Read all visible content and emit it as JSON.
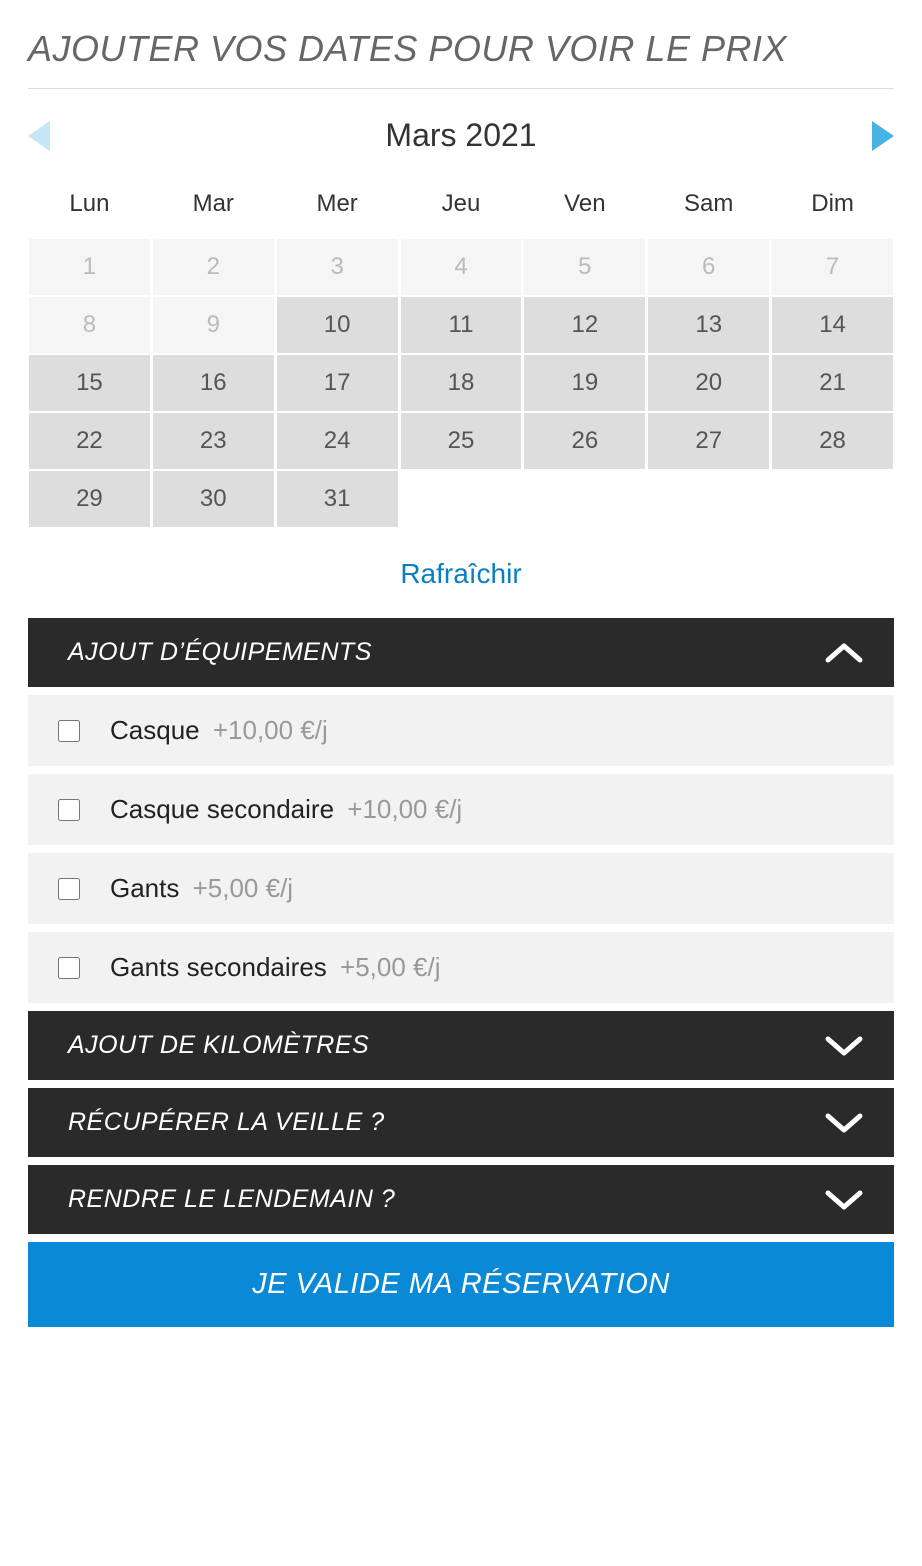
{
  "header": {
    "title": "AJOUTER VOS DATES POUR VOIR LE PRIX"
  },
  "calendar": {
    "month_label": "Mars 2021",
    "dow": [
      "Lun",
      "Mar",
      "Mer",
      "Jeu",
      "Ven",
      "Sam",
      "Dim"
    ],
    "cells": [
      {
        "d": "1",
        "state": "disabled"
      },
      {
        "d": "2",
        "state": "disabled"
      },
      {
        "d": "3",
        "state": "disabled"
      },
      {
        "d": "4",
        "state": "disabled"
      },
      {
        "d": "5",
        "state": "disabled"
      },
      {
        "d": "6",
        "state": "disabled"
      },
      {
        "d": "7",
        "state": "disabled"
      },
      {
        "d": "8",
        "state": "disabled"
      },
      {
        "d": "9",
        "state": "disabled"
      },
      {
        "d": "10",
        "state": "avail"
      },
      {
        "d": "11",
        "state": "avail"
      },
      {
        "d": "12",
        "state": "avail"
      },
      {
        "d": "13",
        "state": "avail"
      },
      {
        "d": "14",
        "state": "avail"
      },
      {
        "d": "15",
        "state": "avail"
      },
      {
        "d": "16",
        "state": "avail"
      },
      {
        "d": "17",
        "state": "avail"
      },
      {
        "d": "18",
        "state": "avail"
      },
      {
        "d": "19",
        "state": "avail"
      },
      {
        "d": "20",
        "state": "avail"
      },
      {
        "d": "21",
        "state": "avail"
      },
      {
        "d": "22",
        "state": "avail"
      },
      {
        "d": "23",
        "state": "avail"
      },
      {
        "d": "24",
        "state": "avail"
      },
      {
        "d": "25",
        "state": "avail"
      },
      {
        "d": "26",
        "state": "avail"
      },
      {
        "d": "27",
        "state": "avail"
      },
      {
        "d": "28",
        "state": "avail"
      },
      {
        "d": "29",
        "state": "avail"
      },
      {
        "d": "30",
        "state": "avail"
      },
      {
        "d": "31",
        "state": "avail"
      },
      {
        "d": "",
        "state": "empty"
      },
      {
        "d": "",
        "state": "empty"
      },
      {
        "d": "",
        "state": "empty"
      },
      {
        "d": "",
        "state": "empty"
      }
    ]
  },
  "refresh_label": "Rafraîchir",
  "sections": {
    "equipment": {
      "title": "AJOUT D’ÉQUIPEMENTS",
      "expanded": true
    },
    "kilometres": {
      "title": "AJOUT DE KILOMÈTRES",
      "expanded": false
    },
    "pickup_eve": {
      "title": "RÉCUPÉRER LA VEILLE ?",
      "expanded": false
    },
    "return_next": {
      "title": "RENDRE LE LENDEMAIN ?",
      "expanded": false
    }
  },
  "equipment_items": [
    {
      "label": "Casque",
      "price": "+10,00 €/j"
    },
    {
      "label": "Casque secondaire",
      "price": "+10,00 €/j"
    },
    {
      "label": "Gants",
      "price": "+5,00 €/j"
    },
    {
      "label": "Gants secondaires",
      "price": "+5,00 €/j"
    }
  ],
  "validate_label": "JE VALIDE MA RÉSERVATION",
  "colors": {
    "accent": "#0a8ad6",
    "calendar_nav": "#6ec1e8"
  }
}
